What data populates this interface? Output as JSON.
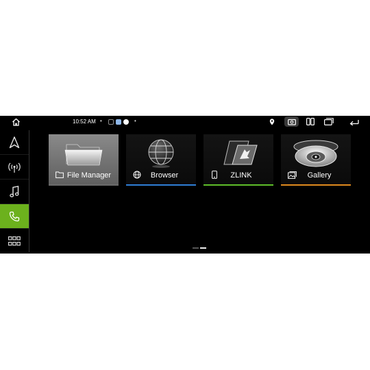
{
  "status_bar": {
    "time": "10:52 AM",
    "dot_left": "•",
    "dot_right": "•"
  },
  "sidebar": {
    "items": [
      {
        "icon": "navigation-icon"
      },
      {
        "icon": "radio-icon"
      },
      {
        "icon": "music-icon"
      },
      {
        "icon": "phone-icon",
        "active": true
      },
      {
        "icon": "apps-grid-icon"
      }
    ],
    "active_color": "#6cb11d"
  },
  "apps": [
    {
      "label": "File Manager",
      "icon": "folder-icon",
      "selected": true,
      "underline_color": "#6a6a6a"
    },
    {
      "label": "Browser",
      "icon": "globe-icon",
      "underline_color": "#2f7fd6"
    },
    {
      "label": "ZLINK",
      "icon": "phone-outline-icon",
      "underline_color": "#5fbf2a"
    },
    {
      "label": "Gallery",
      "icon": "image-icon",
      "underline_color": "#e08a1e"
    }
  ],
  "page_indicator": {
    "pages": 2,
    "current": 2
  }
}
